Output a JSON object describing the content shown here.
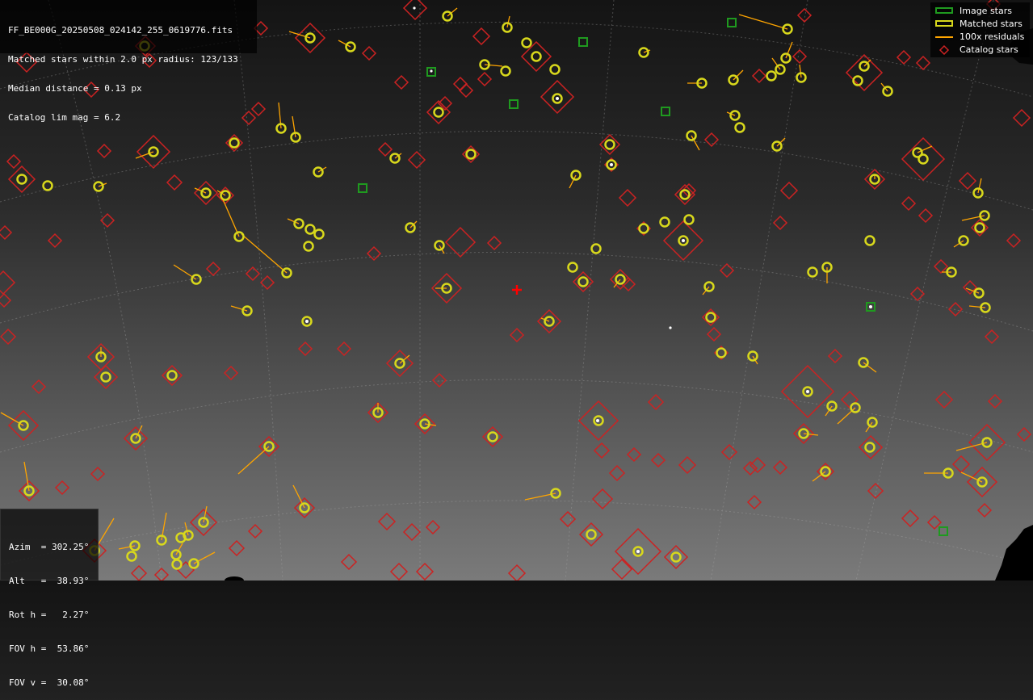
{
  "info": {
    "filename": "FF_BE000G_20250508_024142_255_0619776.fits",
    "matched": "Matched stars within 2.0 px radius: 123/133",
    "median": "Median distance = 0.13 px",
    "limmag": "Catalog lim mag = 6.2"
  },
  "legend": {
    "image_stars": "Image stars",
    "matched_stars": "Matched stars",
    "residuals": "100x residuals",
    "catalog_stars": "Catalog stars"
  },
  "pointing": {
    "azim": "Azim  = 302.25°",
    "alt": "Alt   =  38.93°",
    "rot": "Rot h =   2.27°",
    "fovh": "FOV h =  53.86°",
    "fovv": "FOV v =  30.08°"
  },
  "colors": {
    "image_star": "#1f9a1f",
    "matched_star": "#d8d81c",
    "residual": "#ffa500",
    "catalog_star": "#cc2222",
    "center_marker": "#ff0000"
  }
}
